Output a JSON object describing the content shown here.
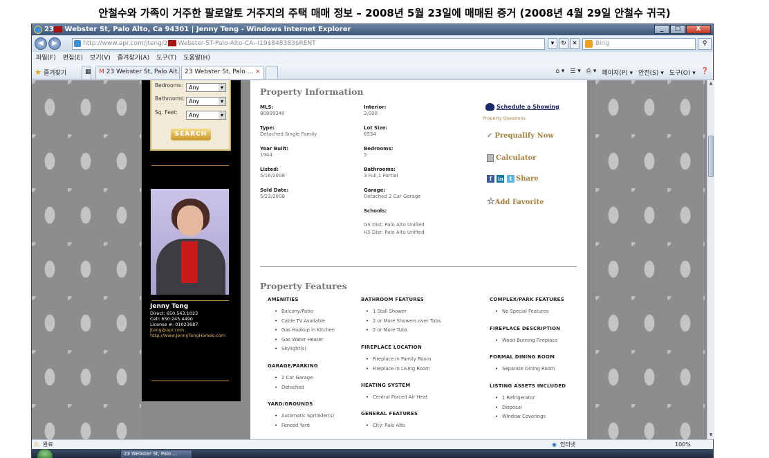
{
  "caption": "안철수와 가족이 거주한 팔로알토 거주지의 주택 매매 정보 – 2008년 5월 23일에 매매된 증거 (2008년 4월 29일 안철수 귀국)",
  "window": {
    "title_prefix": "23",
    "title": "Webster St, Palo Alto, Ca 94301 | Jenny Teng - Windows Internet Explorer",
    "min": "_",
    "max": "□",
    "close": "X"
  },
  "address": {
    "url_host": "http://www.apr.com",
    "url_path": "/jteng/2",
    "url_rest": "-Webster-ST-Palo-Alto-CA--I19$848383$RENT",
    "search_placeholder": "Bing",
    "back": "◀",
    "forward": "▶"
  },
  "menu": [
    "파일(F)",
    "편집(E)",
    "보기(V)",
    "즐겨찾기(A)",
    "도구(T)",
    "도움말(H)"
  ],
  "favbar": {
    "favorites_label": "즐겨찾기",
    "tab1": "23 Webster St, Palo Alt...",
    "tab2": "23 Webster St, Palo ...",
    "commands": [
      "페이지(P) ▾",
      "안전(S) ▾",
      "도구(O) ▾"
    ]
  },
  "sidebar": {
    "search": {
      "bedrooms_label": "Bedrooms:",
      "bedrooms_value": "Any",
      "bathrooms_label": "Bathrooms:",
      "bathrooms_value": "Any",
      "sqfeet_label": "Sq. Feet:",
      "sqfeet_value": "Any",
      "button": "SEARCH"
    },
    "agent": {
      "name": "Jenny Teng",
      "direct": "Direct: 650.543.1023",
      "cell": "Cell: 650.245.4490",
      "license": "License #: 01023687",
      "email": "jteng@apr.com",
      "website": "http://www.JennyTengHomes.com"
    }
  },
  "property_info": {
    "title": "Property Information",
    "mls_label": "MLS:",
    "mls": "80809340",
    "type_label": "Type:",
    "type": "Detached Single Family",
    "year_label": "Year Built:",
    "year": "1944",
    "listed_label": "Listed:",
    "listed": "5/16/2008",
    "sold_label": "Sold Date:",
    "sold": "5/23/2008",
    "interior_label": "Interior:",
    "interior": "3,000",
    "lot_label": "Lot Size:",
    "lot": "6534",
    "bedrooms_label": "Bedrooms:",
    "bedrooms": "5",
    "bathrooms_label": "Bathrooms:",
    "bathrooms": "3 Full,1 Partial",
    "garage_label": "Garage:",
    "garage": "Detached 2 Car Garage",
    "schools_label": "Schools:",
    "gs_dist": "GS Dist: Palo Alto Unified",
    "hs_dist": "HS Dist: Palo Alto Unified"
  },
  "actions": {
    "schedule": "Schedule a Showing",
    "questions": "Property Questions",
    "prequalify": "Prequalify Now",
    "calculator": "Calculator",
    "share": "Share",
    "favorite": "Add Favorite"
  },
  "features": {
    "title": "Property Features",
    "amenities": {
      "head": "AMENITIES",
      "items": [
        "Balcony/Patio",
        "Cable TV Available",
        "Gas Hookup in Kitchen",
        "Gas Water Heater",
        "Skylight(s)"
      ]
    },
    "garage": {
      "head": "GARAGE/PARKING",
      "items": [
        "2 Car Garage",
        "Detached"
      ]
    },
    "yard": {
      "head": "YARD/GROUNDS",
      "items": [
        "Automatic Sprinkler(s)",
        "Fenced Yard"
      ]
    },
    "bathroom": {
      "head": "BATHROOM FEATURES",
      "items": [
        "1 Stall Shower",
        "2 or More Showers over Tubs",
        "2 or More Tubs"
      ]
    },
    "fireplace_loc": {
      "head": "FIREPLACE LOCATION",
      "items": [
        "Fireplace in Family Room",
        "Fireplace in Living Room"
      ]
    },
    "heating": {
      "head": "HEATING SYSTEM",
      "items": [
        "Central Forced Air Heat"
      ]
    },
    "general": {
      "head": "GENERAL FEATURES",
      "items": [
        "City: Palo Alto"
      ]
    },
    "complex": {
      "head": "COMPLEX/PARK FEATURES",
      "items": [
        "No Special Features"
      ]
    },
    "fireplace_desc": {
      "head": "FIREPLACE DESCRIPTION",
      "items": [
        "Wood Burning Fireplace"
      ]
    },
    "dining": {
      "head": "FORMAL DINING ROOM",
      "items": [
        "Separate Dining Room"
      ]
    },
    "assets": {
      "head": "LISTING ASSETS INCLUDED",
      "items": [
        "1 Refrigerator",
        "Disposal",
        "Window Coverings"
      ]
    }
  },
  "status": {
    "done": "완료",
    "zone": "인터넷",
    "zoom": "100%"
  },
  "taskbar": {
    "item": "23 Webster St, Palo ..."
  }
}
